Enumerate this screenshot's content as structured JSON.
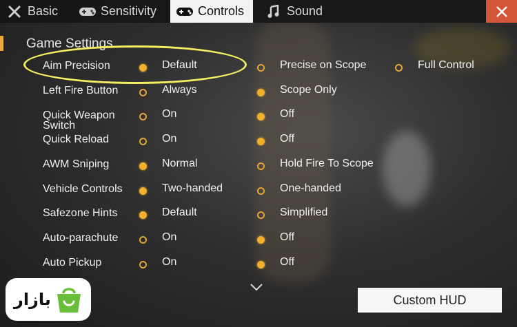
{
  "tabs": [
    {
      "label": "Basic",
      "icon": "wrench-screwdriver-icon",
      "active": false
    },
    {
      "label": "Sensitivity",
      "icon": "gamepad-icon",
      "active": false
    },
    {
      "label": "Controls",
      "icon": "gamepad-icon",
      "active": true
    },
    {
      "label": "Sound",
      "icon": "music-note-icon",
      "active": false
    }
  ],
  "close_icon": "close-icon",
  "section_title": "Game Settings",
  "settings": [
    {
      "label": "Aim Precision",
      "options": [
        "Default",
        "Precise on Scope",
        "Full Control"
      ],
      "selected": 0
    },
    {
      "label": "Left Fire Button",
      "options": [
        "Always",
        "Scope Only"
      ],
      "selected": 1
    },
    {
      "label": "Quick Weapon Switch",
      "options": [
        "On",
        "Off"
      ],
      "selected": 1
    },
    {
      "label": "Quick Reload",
      "options": [
        "On",
        "Off"
      ],
      "selected": 1
    },
    {
      "label": "AWM Sniping",
      "options": [
        "Normal",
        "Hold Fire To Scope"
      ],
      "selected": 0
    },
    {
      "label": "Vehicle Controls",
      "options": [
        "Two-handed",
        "One-handed"
      ],
      "selected": 0
    },
    {
      "label": "Safezone Hints",
      "options": [
        "Default",
        "Simplified"
      ],
      "selected": 0
    },
    {
      "label": "Auto-parachute",
      "options": [
        "On",
        "Off"
      ],
      "selected": 1
    },
    {
      "label": "Auto Pickup",
      "options": [
        "On",
        "Off"
      ],
      "selected": 1
    }
  ],
  "custom_hud_label": "Custom HUD",
  "logo_text": "بازار",
  "colors": {
    "accent": "#f3b02d",
    "close_button": "#d2553a",
    "highlight": "#f4ee62",
    "logo_green": "#6abf3a"
  }
}
